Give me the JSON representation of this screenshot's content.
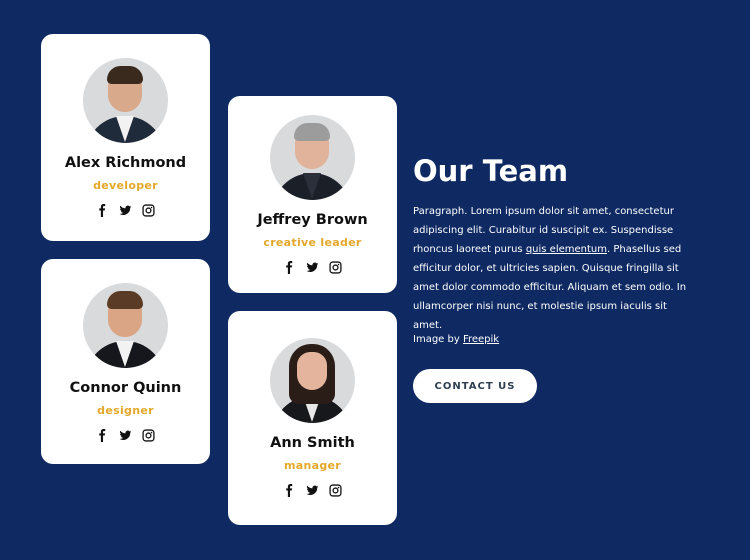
{
  "team": [
    {
      "name": "Alex Richmond",
      "role": "developer"
    },
    {
      "name": "Jeffrey Brown",
      "role": "creative leader"
    },
    {
      "name": "Connor Quinn",
      "role": "designer"
    },
    {
      "name": "Ann Smith",
      "role": "manager"
    }
  ],
  "section": {
    "title": "Our Team",
    "paragraph_before_link": "Paragraph. Lorem ipsum dolor sit amet, consectetur adipiscing elit. Curabitur id suscipit ex. Suspendisse rhoncus laoreet purus ",
    "paragraph_link": "quis elementum",
    "paragraph_after_link": ". Phasellus sed efficitur dolor, et ultricies sapien. Quisque fringilla sit amet dolor commodo efficitur. Aliquam et sem odio. In ullamcorper nisi nunc, et molestie ipsum iaculis sit amet.",
    "credit_prefix": "Image by ",
    "credit_link": "Freepik",
    "cta_label": "CONTACT US"
  },
  "icons": [
    "facebook-icon",
    "twitter-icon",
    "instagram-icon"
  ],
  "colors": {
    "background": "#0f2a63",
    "card": "#ffffff",
    "role_accent": "#e3a82a",
    "button_text": "#2e3f52"
  }
}
